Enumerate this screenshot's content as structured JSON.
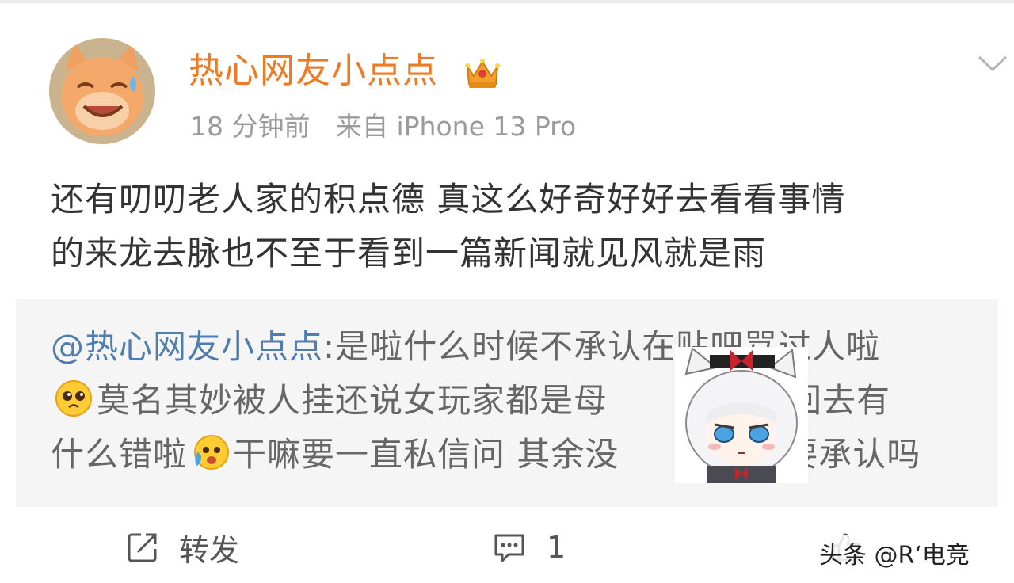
{
  "post": {
    "username": "热心网友小点点",
    "time": "18 分钟前",
    "source": "来自 iPhone 13 Pro",
    "text_lines": [
      "还有叨叨老人家的积点德 真这么好奇好好去看看事情",
      "的来龙去脉也不至于看到一篇新闻就见风就是雨"
    ]
  },
  "quote": {
    "mention": "@热心网友小点点",
    "line1_rest": ":是啦什么时候不承认在贴吧骂过人啦",
    "line2_rest": "莫名其妙被人挂还说女玩家都是母",
    "line2_end": "把骂回去有",
    "line3_start": "什么错啦",
    "line3_mid": "干嘛要一直私信问 其余没",
    "line3_end": "也要承认吗"
  },
  "actions": {
    "repost_label": "转发",
    "comment_count": "1"
  },
  "icons": {
    "avatar": "cartoon-cat-avatar-icon",
    "crown": "crown-badge-icon",
    "menu": "chevron-down-icon",
    "repost": "repost-icon",
    "comment": "comment-icon",
    "like": "thumbs-up-icon",
    "emoji1": "pleading-face-emoji-icon",
    "emoji2": "crying-face-emoji-icon"
  },
  "colors": {
    "username": "#ef7a24",
    "mention": "#507daf",
    "quote_bg": "#f5f5f5",
    "meta_text": "#9b9b9b"
  },
  "watermark": "头条 @R‘电竞"
}
